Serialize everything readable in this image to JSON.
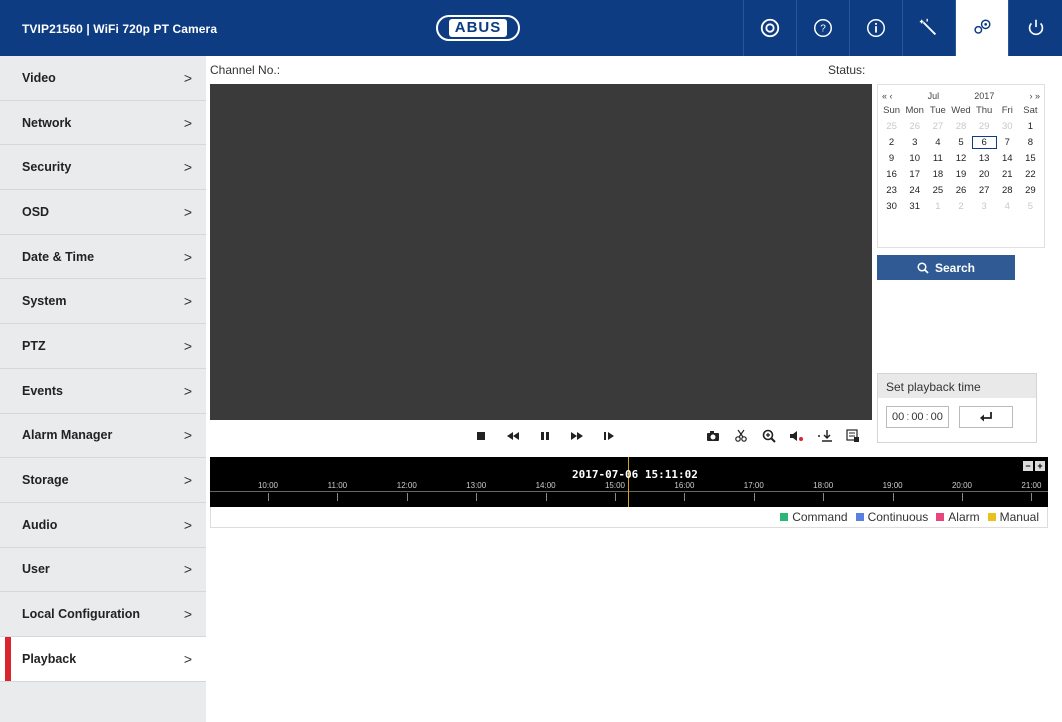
{
  "header": {
    "title": "TVIP21560  |  WiFi 720p PT Camera",
    "logo": "ABUS",
    "buttons": [
      "live-view",
      "help",
      "info",
      "wizard",
      "configuration",
      "logout"
    ]
  },
  "sidebar": {
    "items": [
      {
        "label": "Video"
      },
      {
        "label": "Network"
      },
      {
        "label": "Security"
      },
      {
        "label": "OSD"
      },
      {
        "label": "Date & Time"
      },
      {
        "label": "System"
      },
      {
        "label": "PTZ"
      },
      {
        "label": "Events"
      },
      {
        "label": "Alarm Manager"
      },
      {
        "label": "Storage"
      },
      {
        "label": "Audio"
      },
      {
        "label": "User"
      },
      {
        "label": "Local Configuration"
      },
      {
        "label": "Playback"
      }
    ],
    "chevron": ">",
    "active": "Playback"
  },
  "main": {
    "channel_label": "Channel No.:",
    "status_label": "Status:"
  },
  "calendar": {
    "prev_year": "«",
    "prev_month": "‹",
    "month": "Jul",
    "year": "2017",
    "next_month": "›",
    "next_year": "»",
    "weekdays": [
      "Sun",
      "Mon",
      "Tue",
      "Wed",
      "Thu",
      "Fri",
      "Sat"
    ],
    "weeks": [
      [
        "25",
        "26",
        "27",
        "28",
        "29",
        "30",
        "1"
      ],
      [
        "2",
        "3",
        "4",
        "5",
        "6",
        "7",
        "8"
      ],
      [
        "9",
        "10",
        "11",
        "12",
        "13",
        "14",
        "15"
      ],
      [
        "16",
        "17",
        "18",
        "19",
        "20",
        "21",
        "22"
      ],
      [
        "23",
        "24",
        "25",
        "26",
        "27",
        "28",
        "29"
      ],
      [
        "30",
        "31",
        "1",
        "2",
        "3",
        "4",
        "5"
      ]
    ],
    "selected_day": "6",
    "search_label": "Search"
  },
  "playback_time": {
    "title": "Set playback time",
    "hh": "00",
    "mm": "00",
    "ss": "00",
    "sep": ":"
  },
  "timeline": {
    "current": "2017-07-06 15:11:02",
    "ticks": [
      "10:00",
      "11:00",
      "12:00",
      "13:00",
      "14:00",
      "15:00",
      "16:00",
      "17:00",
      "18:00",
      "19:00",
      "20:00",
      "21:00"
    ]
  },
  "legend": [
    {
      "label": "Command",
      "color": "#2bb673"
    },
    {
      "label": "Continuous",
      "color": "#5a7fe0"
    },
    {
      "label": "Alarm",
      "color": "#e8457a"
    },
    {
      "label": "Manual",
      "color": "#e8c21a"
    }
  ],
  "colors": {
    "header": "#0d3c82",
    "accent": "#d9262e",
    "search_button": "#2f5a94"
  }
}
